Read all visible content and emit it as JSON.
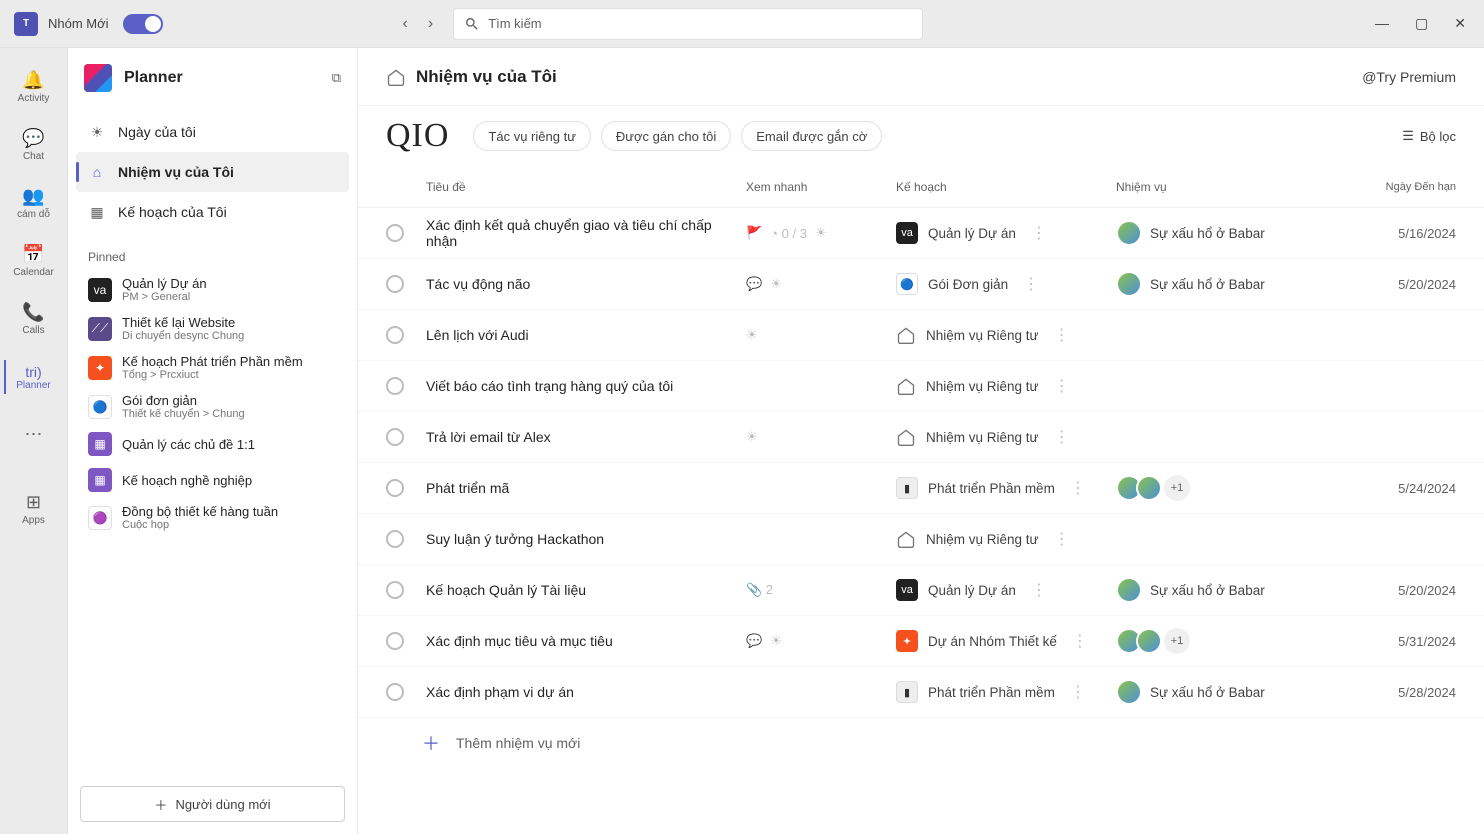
{
  "titlebar": {
    "app_label": "Nhóm Mới",
    "search_placeholder": "Tìm kiếm"
  },
  "rail": {
    "activity": "Activity",
    "chat": "Chat",
    "camdo": "cám dỗ",
    "calendar": "Calendar",
    "calls": "Calls",
    "planner_txt": "tri)",
    "planner": "Planner",
    "apps": "Apps"
  },
  "sidebar": {
    "title": "Planner",
    "nav": {
      "myday": "Ngày của tôi",
      "mytasks": "Nhiệm vụ của Tôi",
      "myplans": "Kế hoạch của Tôi"
    },
    "pinned_label": "Pinned",
    "pinned": [
      {
        "name": "Quản lý Dự án",
        "sub": "PM &gt; General",
        "color": "#212121",
        "glyph": "va"
      },
      {
        "name": "Thiết kế lại Website",
        "sub": "Di chuyển desync  Chung",
        "color": "#5b4a8a",
        "glyph": "⟋⟋"
      },
      {
        "name": "Kế hoạch Phát triển Phần mềm",
        "sub": "Tổng &gt; Prcxiuct",
        "color": "#f4511e",
        "glyph": "✦"
      },
      {
        "name": "Gói đơn giản",
        "sub": "Thiết kế chuyển &gt; Chung",
        "color": "#ffffff",
        "glyph": "🔵"
      },
      {
        "name": "Quản lý các chủ đề 1:1",
        "sub": "",
        "color": "#7e57c2",
        "glyph": "▦"
      },
      {
        "name": "Kế hoạch nghề nghiệp",
        "sub": "",
        "color": "#7e57c2",
        "glyph": "▦"
      },
      {
        "name": "Đồng bộ thiết kế hàng tuần",
        "sub": "Cuộc họp",
        "color": "#ffffff",
        "glyph": "🟣"
      }
    ],
    "new_user": "Người dùng mới"
  },
  "main": {
    "header_title": "Nhiệm vụ của Tôi",
    "premium": "@Try Premium",
    "big_label": "QIO",
    "pills": [
      "Tác vụ riêng tư",
      "Được gán cho tôi",
      "Email được gắn cờ"
    ],
    "filter": "Bộ lọc",
    "columns": {
      "title": "Tiêu đề",
      "quick": "Xem nhanh",
      "plan": "Kế hoạch",
      "assign": "Nhiệm vụ",
      "date": "Ngày Đến hạn"
    },
    "add_task": "Thêm nhiệm vụ mới"
  },
  "tasks": [
    {
      "title": "Xác định kết quả chuyển giao và tiêu chí chấp nhận",
      "quick": "flag progress sun",
      "progress": "0 / 3",
      "plan": "Quản lý Dự án",
      "plan_color": "#212121",
      "plan_glyph": "va",
      "plan_icon": "",
      "assign_name": "Sự xấu hổ ở Babar",
      "assign_type": "single",
      "date": "5/16/2024"
    },
    {
      "title": "Tác vụ động não",
      "quick": "bubble sun",
      "plan": "Gói Đơn giản",
      "plan_color": "#fff",
      "plan_glyph": "🔵",
      "plan_icon": "",
      "assign_name": "Sự xấu hổ ở Babar",
      "assign_type": "single",
      "date": "5/20/2024"
    },
    {
      "title": "Lên lịch với Audi",
      "quick": "sun",
      "plan": "Nhiệm vụ Riêng tư",
      "plan_color": "",
      "plan_icon": "home",
      "assign_name": "",
      "assign_type": "none",
      "date": ""
    },
    {
      "title": "Viết báo cáo tình trạng hàng quý của tôi",
      "quick": "",
      "plan": "Nhiệm vụ Riêng tư",
      "plan_color": "",
      "plan_icon": "home",
      "assign_name": "",
      "assign_type": "none",
      "date": ""
    },
    {
      "title": "Trả lời email từ Alex",
      "quick": "sun",
      "plan": "Nhiệm vụ Riêng tư",
      "plan_color": "",
      "plan_icon": "home",
      "assign_name": "",
      "assign_type": "none",
      "date": ""
    },
    {
      "title": "Phát triển mã",
      "quick": "",
      "plan": "Phát triển Phần mềm",
      "plan_color": "#eee",
      "plan_glyph": "▮",
      "plan_icon": "",
      "assign_name": "",
      "assign_type": "multi",
      "assign_extra": "+1",
      "date": "5/24/2024"
    },
    {
      "title": "Suy luận ý tưởng Hackathon",
      "quick": "",
      "plan": "Nhiệm vụ Riêng tư",
      "plan_color": "",
      "plan_icon": "home",
      "assign_name": "",
      "assign_type": "none",
      "date": ""
    },
    {
      "title": "Kế hoạch Quản lý Tài liệu",
      "quick": "clip",
      "progress": "2",
      "plan": "Quản lý Dự án",
      "plan_color": "#212121",
      "plan_glyph": "va",
      "plan_icon": "",
      "assign_name": "Sự xấu hổ ở Babar",
      "assign_type": "single",
      "date": "5/20/2024"
    },
    {
      "title": "Xác định mục tiêu và mục tiêu",
      "quick": "bubble sun",
      "plan": "Dự án Nhóm Thiết kế",
      "plan_color": "#f4511e",
      "plan_glyph": "✦",
      "plan_icon": "",
      "assign_name": "",
      "assign_type": "multi",
      "assign_extra": "+1",
      "date": "5/31/2024"
    },
    {
      "title": "Xác định phạm vi dự án",
      "quick": "",
      "plan": "Phát triển Phần mềm",
      "plan_color": "#eee",
      "plan_glyph": "▮",
      "plan_icon": "",
      "assign_name": "Sự xấu hổ ở Babar",
      "assign_type": "single",
      "date": "5/28/2024"
    }
  ]
}
